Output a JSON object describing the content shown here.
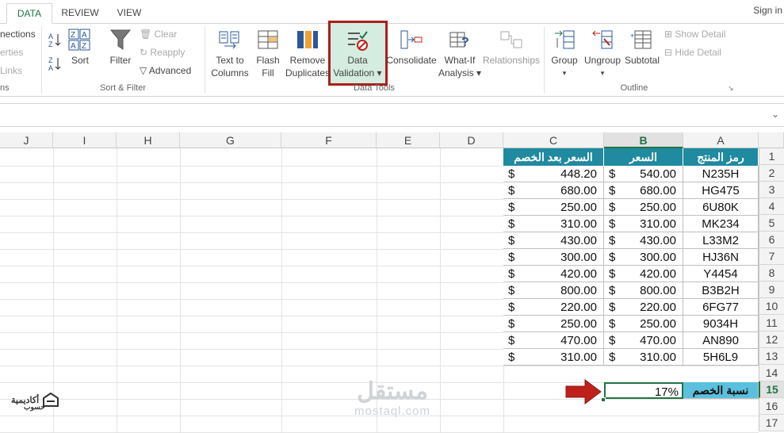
{
  "tabs": [
    "DATA",
    "REVIEW",
    "VIEW"
  ],
  "signin": "Sign in",
  "ribbon": {
    "connections_partial": [
      "nections",
      "erties",
      "Links"
    ],
    "connections_group_partial": "ns",
    "sort_filter": {
      "sort": "Sort",
      "filter": "Filter",
      "clear": "Clear",
      "reapply": "Reapply",
      "advanced": "Advanced",
      "group_label": "Sort & Filter"
    },
    "data_tools": {
      "text_to_columns": [
        "Text to",
        "Columns"
      ],
      "flash_fill": [
        "Flash",
        "Fill"
      ],
      "remove_duplicates": [
        "Remove",
        "Duplicates"
      ],
      "data_validation": [
        "Data",
        "Validation ▾"
      ],
      "consolidate": "Consolidate",
      "what_if": [
        "What-If",
        "Analysis ▾"
      ],
      "relationships": "Relationships",
      "group_label": "Data Tools"
    },
    "outline": {
      "group": "Group",
      "ungroup": "Ungroup",
      "subtotal": "Subtotal",
      "show_detail": "Show Detail",
      "hide_detail": "Hide Detail",
      "group_label": "Outline"
    }
  },
  "columns": [
    "J",
    "I",
    "H",
    "G",
    "F",
    "E",
    "D",
    "C",
    "B",
    "A"
  ],
  "rows": [
    "1",
    "2",
    "3",
    "4",
    "5",
    "6",
    "7",
    "8",
    "9",
    "10",
    "11",
    "12",
    "13",
    "14",
    "15",
    "16",
    "17"
  ],
  "table": {
    "headers": {
      "code": "رمز المنتج",
      "price": "السعر",
      "discounted": "السعر بعد الخصم"
    },
    "currency": "$",
    "rows": [
      {
        "code": "N235H",
        "price": "540.00",
        "discounted": "448.20"
      },
      {
        "code": "HG475",
        "price": "680.00",
        "discounted": "680.00"
      },
      {
        "code": "6U80K",
        "price": "250.00",
        "discounted": "250.00"
      },
      {
        "code": "MK234",
        "price": "310.00",
        "discounted": "310.00"
      },
      {
        "code": "L33M2",
        "price": "430.00",
        "discounted": "430.00"
      },
      {
        "code": "HJ36N",
        "price": "300.00",
        "discounted": "300.00"
      },
      {
        "code": "Y4454",
        "price": "420.00",
        "discounted": "420.00"
      },
      {
        "code": "B3B2H",
        "price": "800.00",
        "discounted": "800.00"
      },
      {
        "code": "6FG77",
        "price": "220.00",
        "discounted": "220.00"
      },
      {
        "code": "9034H",
        "price": "250.00",
        "discounted": "250.00"
      },
      {
        "code": "AN890",
        "price": "470.00",
        "discounted": "470.00"
      },
      {
        "code": "5H6L9",
        "price": "310.00",
        "discounted": "310.00"
      }
    ],
    "discount_label": "نسبة الخصم",
    "discount_value": "17%"
  },
  "watermark": {
    "logo": "مستقل",
    "url": "mostaql.com"
  },
  "brand": {
    "line1": "أكاديمية",
    "line2": "حسوب"
  },
  "colors": {
    "accent": "#217346",
    "table_header": "#1f8aa0",
    "label_cell": "#5bc0de",
    "highlight_border": "#a8201a",
    "arrow": "#c0201a"
  }
}
